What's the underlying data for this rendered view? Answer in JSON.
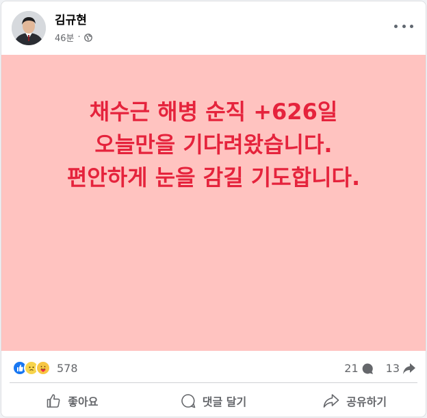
{
  "post": {
    "author": "김규현",
    "time": "46분",
    "separator": "·",
    "privacy_icon": "globe-icon",
    "more_icon": "more-horizontal-icon",
    "background_color": "#ffc3c0",
    "text_color": "#e5233c",
    "text_lines": [
      "채수근 해병 순직 +626일",
      "오늘만을 기다려왔습니다.",
      "편안하게 눈을 감길 기도합니다."
    ]
  },
  "stats": {
    "reaction_icons": [
      "like-icon",
      "sad-icon",
      "care-icon"
    ],
    "reaction_count": "578",
    "comment_count": "21",
    "share_count": "13"
  },
  "actions": {
    "like": "좋아요",
    "comment": "댓글 달기",
    "share": "공유하기"
  }
}
